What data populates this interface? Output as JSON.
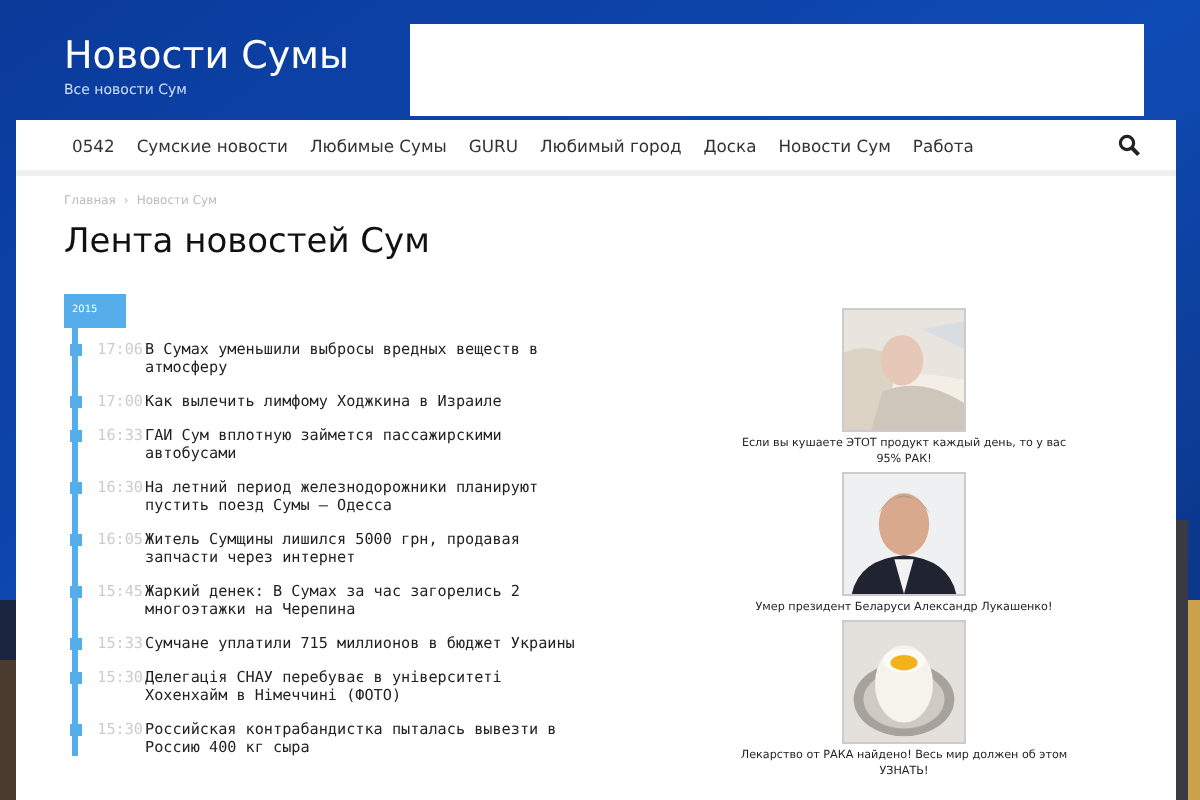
{
  "site": {
    "title": "Новости Сумы",
    "tagline": "Все новости Сум"
  },
  "nav": {
    "items": [
      "0542",
      "Сумские новости",
      "Любимые Сумы",
      "GURU",
      "Любимый город",
      "Доска",
      "Новости Сум",
      "Работа"
    ]
  },
  "breadcrumb": {
    "items": [
      "Главная",
      "Новости Сум"
    ],
    "separator": "›"
  },
  "heading": "Лента новостей Сум",
  "timeline": {
    "year": "2015",
    "items": [
      {
        "time": "17:06",
        "title": "В Сумах уменьшили выбросы вредных веществ в атмосферу"
      },
      {
        "time": "17:00",
        "title": "Как вылечить лимфому Ходжкина в Израиле"
      },
      {
        "time": "16:33",
        "title": "ГАИ Сум вплотную займется пассажирскими автобусами"
      },
      {
        "time": "16:30",
        "title": "На летний период железнодорожники планируют пустить поезд Сумы – Одесса"
      },
      {
        "time": "16:05",
        "title": "Житель Сумщины лишился 5000 грн, продавая запчасти через интернет"
      },
      {
        "time": "15:45",
        "title": "Жаркий денек: В Сумах за час загорелись 2 многоэтажки на Черепина"
      },
      {
        "time": "15:33",
        "title": "Сумчане уплатили 715 миллионов в бюджет Украины"
      },
      {
        "time": "15:30",
        "title": "Делегація СНАУ перебуває в університеті Хохенхайм в Німеччині (ФОТО)"
      },
      {
        "time": "15:30",
        "title": "Российская контрабандистка пыталась вывезти в Россию 400 кг сыра"
      }
    ]
  },
  "ads": [
    {
      "kind": "patient",
      "caption": "Если вы кушаете ЭТОТ продукт каждый день, то у вас 95% РАК!"
    },
    {
      "kind": "portrait",
      "caption": "Умер президент Беларуси Александр Лукашенко!"
    },
    {
      "kind": "egg",
      "caption": "Лекарство от РАКА найдено! Весь мир должен об этом УЗНАТЬ!"
    }
  ]
}
